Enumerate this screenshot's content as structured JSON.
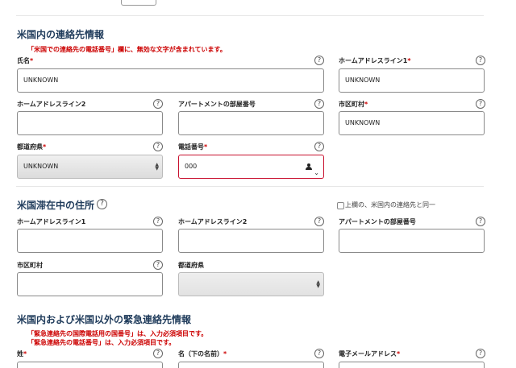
{
  "sections": {
    "us_contact": {
      "title": "米国内の連絡先情報",
      "error": "「米国での連絡先の電話番号」欄に、無効な文字が含まれています。",
      "name": {
        "label": "氏名",
        "value": "UNKNOWN"
      },
      "address_line1": {
        "label": "ホームアドレスライン1",
        "value": "UNKNOWN"
      },
      "address_line2": {
        "label": "ホームアドレスライン2",
        "value": ""
      },
      "apartment": {
        "label": "アパートメントの部屋番号",
        "value": ""
      },
      "city": {
        "label": "市区町村",
        "value": "UNKNOWN"
      },
      "state": {
        "label": "都道府県",
        "value": "UNKNOWN"
      },
      "phone": {
        "label": "電話番号",
        "value": "000"
      }
    },
    "us_residence": {
      "title": "米国滞在中の住所",
      "same_as_above_label": "上欄の、米国内の連絡先と同一",
      "address_line1": {
        "label": "ホームアドレスライン1",
        "value": ""
      },
      "address_line2": {
        "label": "ホームアドレスライン2",
        "value": ""
      },
      "apartment": {
        "label": "アパートメントの部屋番号",
        "value": ""
      },
      "city": {
        "label": "市区町村",
        "value": ""
      },
      "state": {
        "label": "都道府県",
        "value": ""
      }
    },
    "emergency": {
      "title": "米国内および米国以外の緊急連絡先情報",
      "error1": "「緊急連絡先の国際電話用の国番号」は、入力必須項目です。",
      "error2": "「緊急連絡先の電話番号」は、入力必須項目です。",
      "surname": {
        "label": "姓"
      },
      "given_name": {
        "label": "名（下の名前）"
      },
      "email": {
        "label": "電子メールアドレス"
      }
    }
  },
  "common": {
    "required_mark": "*",
    "help_symbol": "?"
  },
  "icons": {
    "help": "help-circle-icon",
    "phone_contact": "person-icon",
    "dropdown": "chevron-down-icon",
    "select_arrows": "select-arrows-icon"
  },
  "colors": {
    "title": "#1f3b5b",
    "error": "#cc0000",
    "error_border": "#c8102e"
  }
}
